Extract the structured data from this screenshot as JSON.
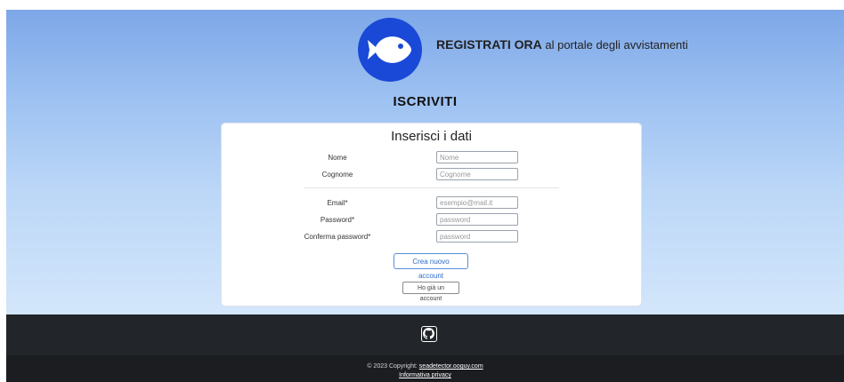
{
  "header": {
    "headline_bold": "REGISTRATI ORA",
    "headline_rest": " al portale degli avvistamenti",
    "logo_icon": "fish-icon",
    "logo_color": "#1a49d8"
  },
  "section_title": "ISCRIVITI",
  "form": {
    "title": "Inserisci i dati",
    "fields": [
      {
        "label": "Nome",
        "placeholder": "Nome",
        "value": ""
      },
      {
        "label": "Cognome",
        "placeholder": "Cognome",
        "value": ""
      },
      {
        "label": "Email*",
        "placeholder": "esempio@mail.it",
        "value": ""
      },
      {
        "label": "Password*",
        "placeholder": "password",
        "value": ""
      },
      {
        "label": "Conferma password*",
        "placeholder": "password",
        "value": ""
      }
    ],
    "create_button": "Crea nuovo account",
    "login_button": "Ho già un account"
  },
  "footer": {
    "icon": "github-icon",
    "copyright_prefix": "© 2023 Copyright: ",
    "copyright_link": "seadetector.ooguy.com",
    "privacy_link": "Informativa privacy"
  }
}
